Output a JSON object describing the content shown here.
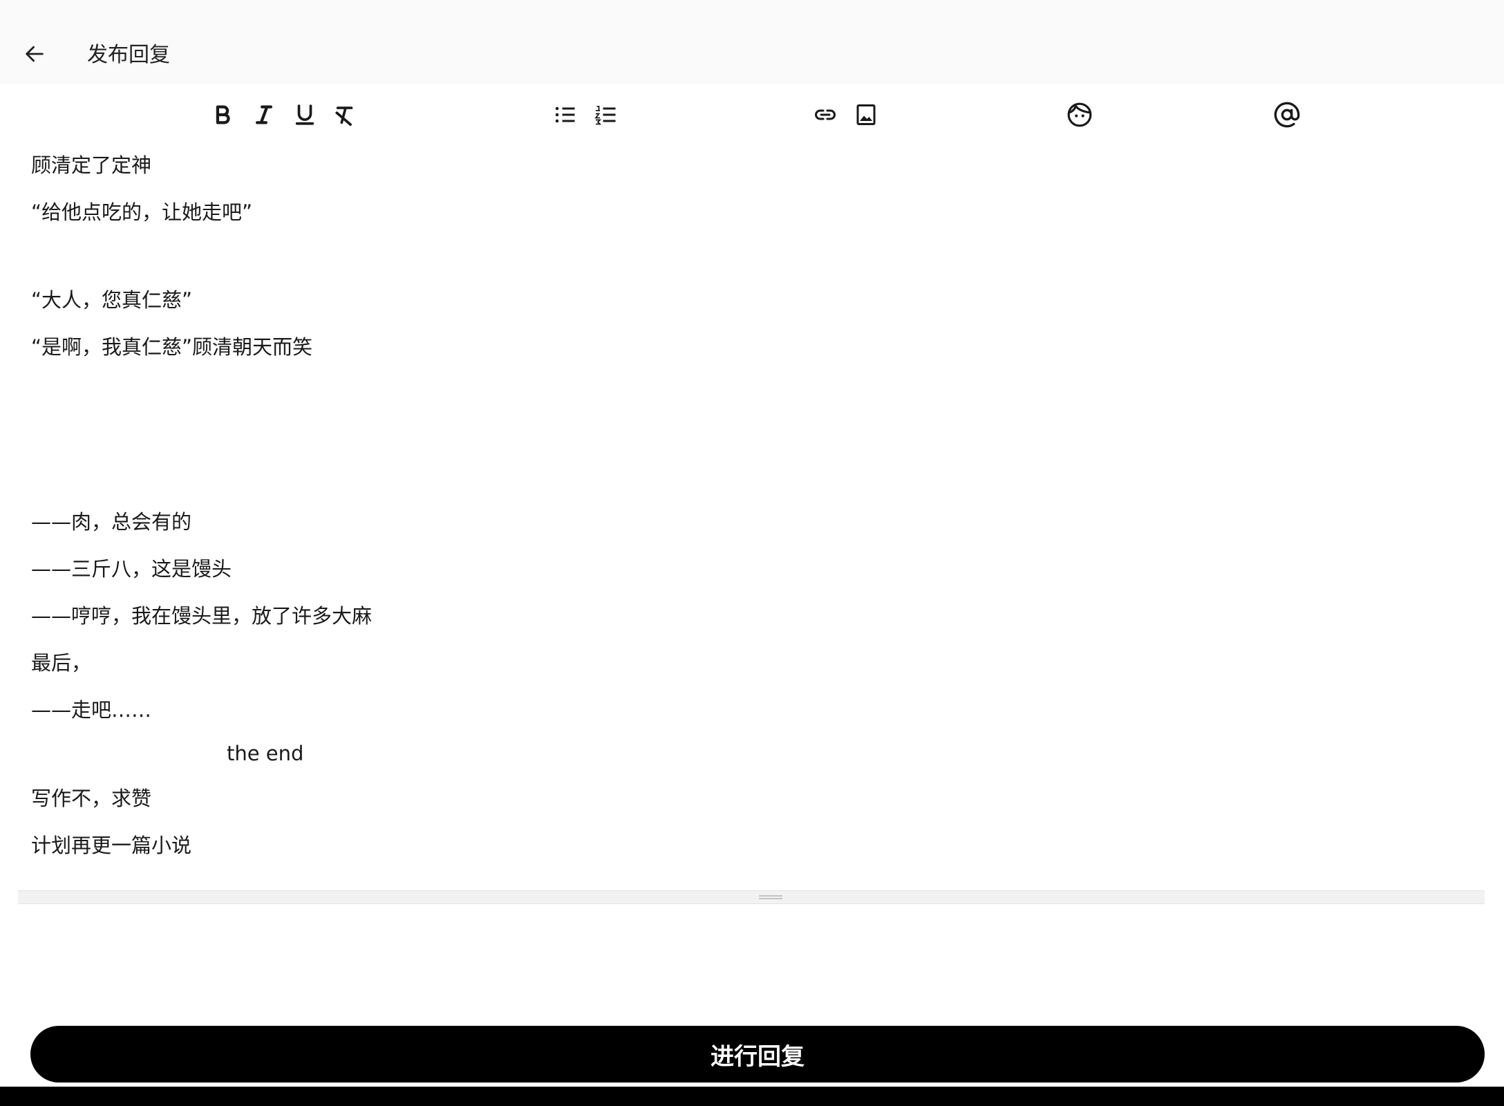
{
  "header": {
    "back_icon": "arrow-left-icon",
    "title": "发布回复"
  },
  "toolbar": {
    "groups": [
      [
        "bold-icon",
        "italic-icon",
        "underline-icon",
        "clear-format-icon"
      ],
      [
        "bulleted-list-icon",
        "numbered-list-icon"
      ],
      [
        "link-icon",
        "image-icon"
      ],
      [
        "emoji-icon"
      ],
      [
        "mention-icon"
      ]
    ]
  },
  "editor": {
    "lines": [
      "顾清定了定神",
      "“给他点吃的，让她走吧”",
      "“大人，您真仁慈”",
      "“是啊，我真仁慈”顾清朝天而笑",
      "——肉，总会有的",
      "——三斤八，这是馒头",
      "——哼哼，我在馒头里，放了许多大麻",
      "最后，",
      "——走吧……",
      "the end",
      "写作不，求赞",
      "计划再更一篇小说"
    ]
  },
  "submit": {
    "label": "进行回复"
  },
  "colors": {
    "button_bg": "#000000",
    "button_text": "#ffffff",
    "header_bg": "#fafafa",
    "text": "#1a1a1a"
  }
}
